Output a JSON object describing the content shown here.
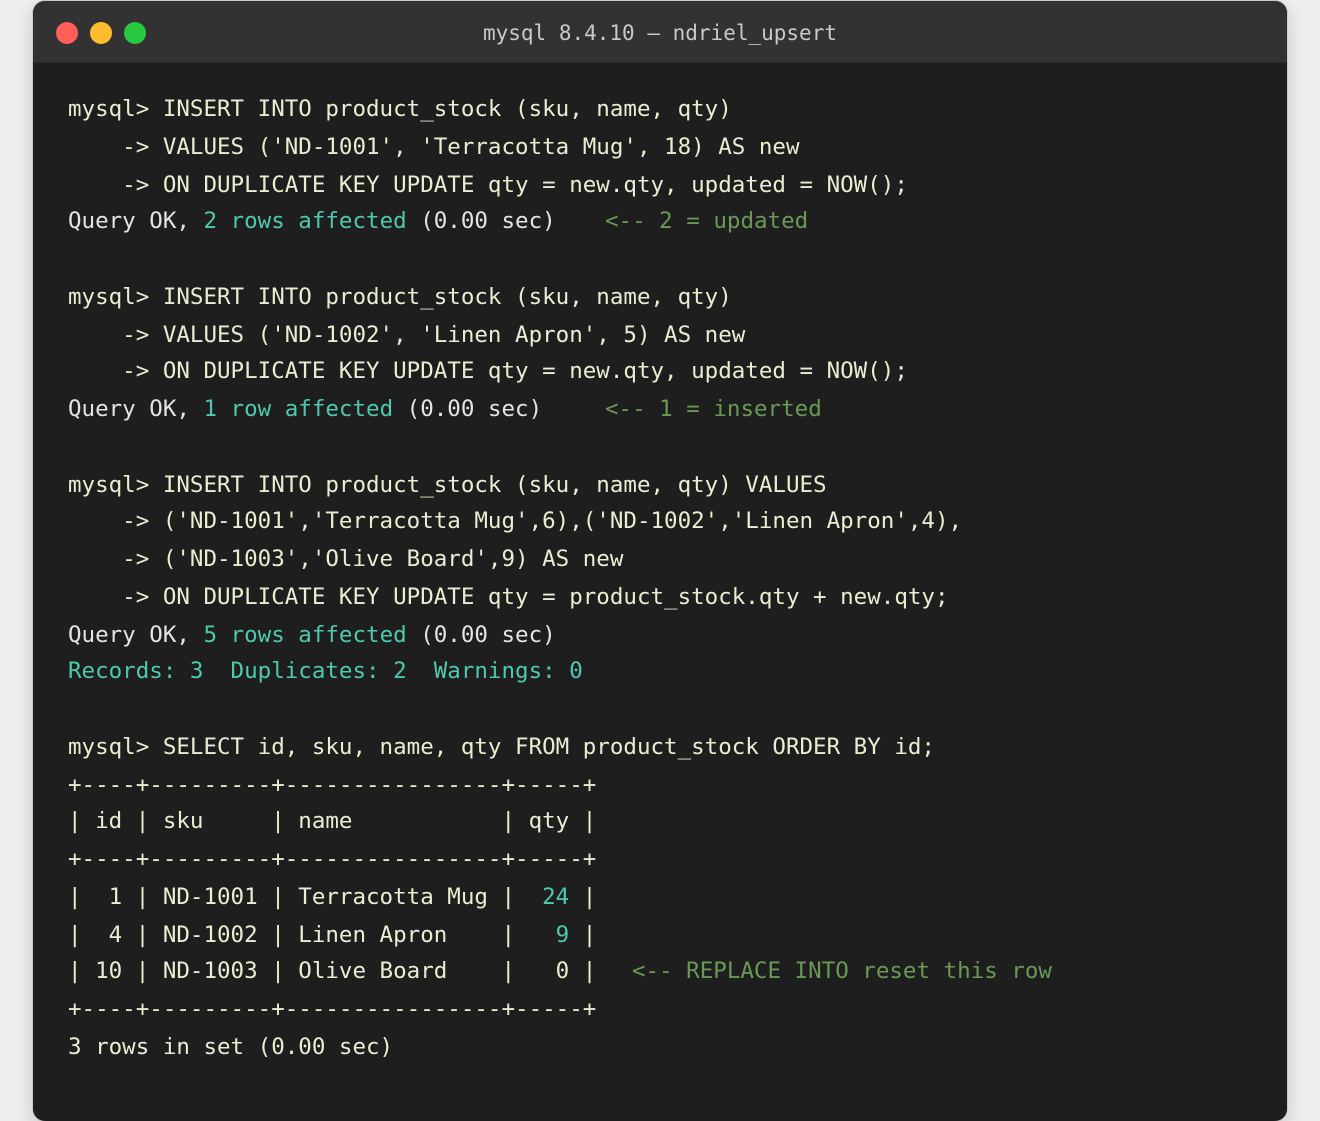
{
  "window": {
    "title": "mysql 8.4.10 — ndriel_upsert"
  },
  "colors": {
    "background": "#1e1e1e",
    "titlebar": "#323232",
    "text": "#ececd2",
    "accent_teal": "#4ec9b0",
    "comment_green": "#6a9955",
    "close": "#ff5f57",
    "minimize": "#febc2e",
    "maximize": "#28c840"
  },
  "terminal": {
    "block1": {
      "l1": "mysql> INSERT INTO product_stock (sku, name, qty)",
      "l2": "    -> VALUES ('ND-1001', 'Terracotta Mug', 18) AS new",
      "l3": "    -> ON DUPLICATE KEY UPDATE qty = new.qty, updated = NOW();",
      "res_prefix": "Query OK, ",
      "res_count": "2 rows affected",
      "res_suffix": " (0.00 sec)",
      "comment": "<-- 2 = updated"
    },
    "block2": {
      "l1": "mysql> INSERT INTO product_stock (sku, name, qty)",
      "l2": "    -> VALUES ('ND-1002', 'Linen Apron', 5) AS new",
      "l3": "    -> ON DUPLICATE KEY UPDATE qty = new.qty, updated = NOW();",
      "res_prefix": "Query OK, ",
      "res_count": "1 row affected",
      "res_suffix": " (0.00 sec)",
      "comment": "<-- 1 = inserted"
    },
    "block3": {
      "l1": "mysql> INSERT INTO product_stock (sku, name, qty) VALUES",
      "l2": "    -> ('ND-1001','Terracotta Mug',6),('ND-1002','Linen Apron',4),",
      "l3": "    -> ('ND-1003','Olive Board',9) AS new",
      "l4": "    -> ON DUPLICATE KEY UPDATE qty = product_stock.qty + new.qty;",
      "res_prefix": "Query OK, ",
      "res_count": "5 rows affected",
      "res_suffix": " (0.00 sec)",
      "records": "Records: 3  Duplicates: 2  Warnings: 0"
    },
    "block4": {
      "l1": "mysql> SELECT id, sku, name, qty FROM product_stock ORDER BY id;",
      "border": "+----+---------+----------------+-----+",
      "header": "| id | sku     | name           | qty |",
      "rows": [
        {
          "pre": "|  1 | ND-1001 | Terracotta Mug |  ",
          "qty": "24",
          "post": " |"
        },
        {
          "pre": "|  4 | ND-1002 | Linen Apron    |   ",
          "qty": "9",
          "post": " |"
        },
        {
          "pre": "| 10 | ND-1003 | Olive Board    |   ",
          "qty": "0",
          "post": " |",
          "comment": "<-- REPLACE INTO reset this row"
        }
      ],
      "footer": "3 rows in set (0.00 sec)"
    }
  }
}
